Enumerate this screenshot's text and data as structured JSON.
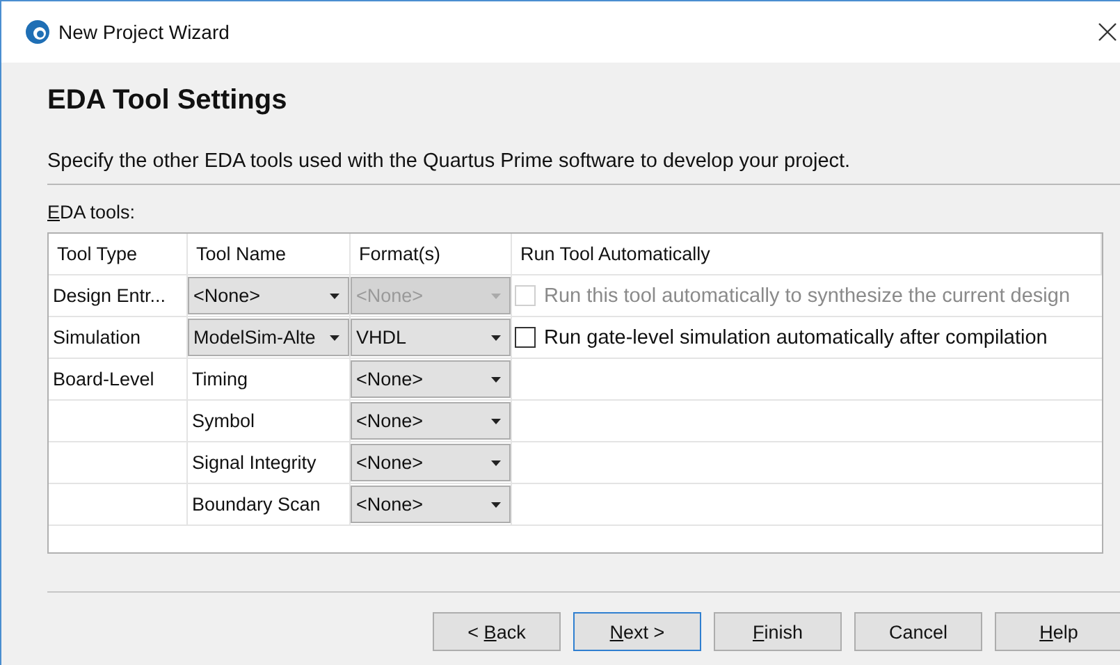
{
  "window": {
    "title": "New Project Wizard"
  },
  "heading": "EDA Tool Settings",
  "description": "Specify the other EDA tools used with the Quartus Prime software to develop your project.",
  "group_label": {
    "key": "E",
    "after": "DA tools:"
  },
  "table": {
    "columns": [
      "Tool Type",
      "Tool Name",
      "Format(s)",
      "Run Tool Automatically"
    ],
    "rows": [
      {
        "tool_type": "Design Entr...",
        "tool_name": {
          "kind": "combo",
          "value": "<None>",
          "disabled": false
        },
        "format": {
          "value": "<None>",
          "disabled": true
        },
        "run": {
          "label": "Run this tool automatically to synthesize the current design",
          "checked": false,
          "disabled": true
        }
      },
      {
        "tool_type": "Simulation",
        "tool_name": {
          "kind": "combo",
          "value": "ModelSim-Alte",
          "disabled": false
        },
        "format": {
          "value": "VHDL",
          "disabled": false
        },
        "run": {
          "label": "Run gate-level simulation automatically after compilation",
          "checked": false,
          "disabled": false
        }
      },
      {
        "tool_type": "Board-Level",
        "tool_name": {
          "kind": "text",
          "value": "Timing"
        },
        "format": {
          "value": "<None>",
          "disabled": false
        }
      },
      {
        "tool_name": {
          "kind": "text",
          "value": "Symbol"
        },
        "format": {
          "value": "<None>",
          "disabled": false
        }
      },
      {
        "tool_name": {
          "kind": "text",
          "value": "Signal Integrity"
        },
        "format": {
          "value": "<None>",
          "disabled": false
        }
      },
      {
        "tool_name": {
          "kind": "text",
          "value": "Boundary Scan"
        },
        "format": {
          "value": "<None>",
          "disabled": false
        }
      }
    ]
  },
  "buttons": [
    {
      "before": "< ",
      "key": "B",
      "after": "ack",
      "default": false
    },
    {
      "key": "N",
      "after": "ext >",
      "default": true
    },
    {
      "key": "F",
      "after": "inish",
      "default": false
    },
    {
      "before": "Cancel",
      "default": false
    },
    {
      "key": "H",
      "after": "elp",
      "default": false
    }
  ]
}
